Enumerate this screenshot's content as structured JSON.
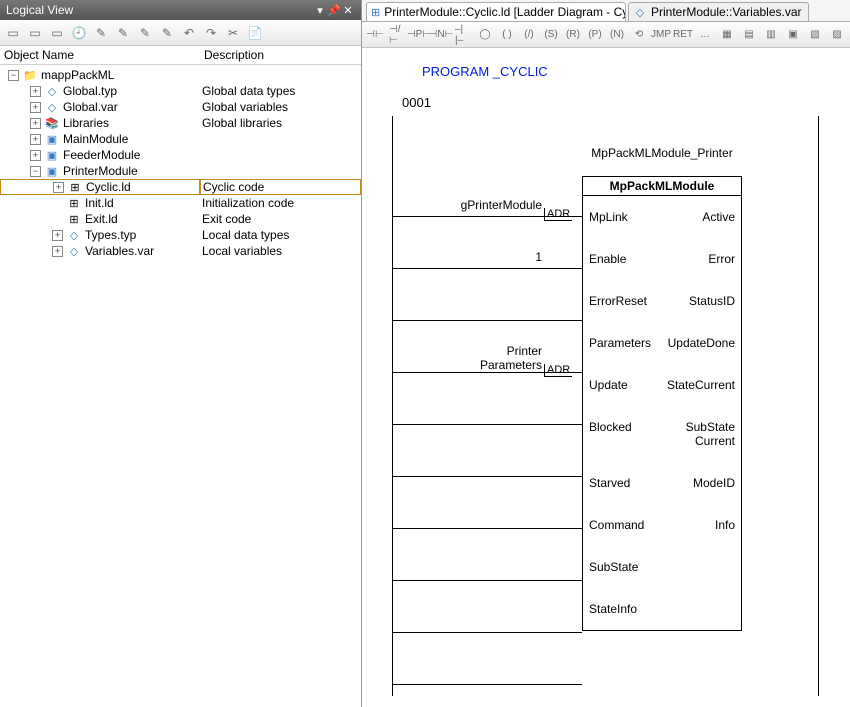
{
  "left": {
    "title": "Logical View",
    "columns": {
      "name": "Object Name",
      "desc": "Description"
    },
    "tree": [
      {
        "indent": 0,
        "toggle": "−",
        "icon": "folder",
        "label": "mappPackML",
        "desc": ""
      },
      {
        "indent": 1,
        "toggle": "+",
        "icon": "file",
        "label": "Global.typ",
        "desc": "Global data types"
      },
      {
        "indent": 1,
        "toggle": "+",
        "icon": "file",
        "label": "Global.var",
        "desc": "Global variables"
      },
      {
        "indent": 1,
        "toggle": "+",
        "icon": "lib",
        "label": "Libraries",
        "desc": "Global libraries"
      },
      {
        "indent": 1,
        "toggle": "+",
        "icon": "pkg",
        "label": "MainModule",
        "desc": ""
      },
      {
        "indent": 1,
        "toggle": "+",
        "icon": "pkg",
        "label": "FeederModule",
        "desc": ""
      },
      {
        "indent": 1,
        "toggle": "−",
        "icon": "pkg",
        "label": "PrinterModule",
        "desc": ""
      },
      {
        "indent": 2,
        "toggle": "+",
        "icon": "ld",
        "label": "Cyclic.ld",
        "desc": "Cyclic code",
        "selected": true
      },
      {
        "indent": 2,
        "toggle": "",
        "icon": "ld",
        "label": "Init.ld",
        "desc": "Initialization code"
      },
      {
        "indent": 2,
        "toggle": "",
        "icon": "ld",
        "label": "Exit.ld",
        "desc": "Exit code"
      },
      {
        "indent": 2,
        "toggle": "+",
        "icon": "file",
        "label": "Types.typ",
        "desc": "Local data types"
      },
      {
        "indent": 2,
        "toggle": "+",
        "icon": "file",
        "label": "Variables.var",
        "desc": "Local variables"
      }
    ]
  },
  "tabs": [
    {
      "label": "PrinterModule::Cyclic.ld [Ladder Diagram - Cyclic]*",
      "active": true,
      "closable": true
    },
    {
      "label": "PrinterModule::Variables.var",
      "active": false,
      "closable": false
    }
  ],
  "editor": {
    "program": "PROGRAM _CYCLIC",
    "network": "0001",
    "instance": "MpPackMLModule_Printer",
    "block_type": "MpPackMLModule",
    "inputs": [
      {
        "sig": "gPrinterModule",
        "adr": "ADR",
        "pin": "MpLink"
      },
      {
        "sig": "1",
        "adr": "",
        "pin": "Enable"
      },
      {
        "sig": "",
        "adr": "",
        "pin": "ErrorReset"
      },
      {
        "sig": "PrinterParameters",
        "adr": "ADR",
        "pin": "Parameters"
      },
      {
        "sig": "",
        "adr": "",
        "pin": "Update"
      },
      {
        "sig": "",
        "adr": "",
        "pin": "Blocked"
      },
      {
        "sig": "",
        "adr": "",
        "pin": "Starved"
      },
      {
        "sig": "",
        "adr": "",
        "pin": "Command"
      },
      {
        "sig": "",
        "adr": "",
        "pin": "SubState"
      },
      {
        "sig": "",
        "adr": "",
        "pin": "StateInfo"
      }
    ],
    "outputs": [
      "Active",
      "Error",
      "StatusID",
      "UpdateDone",
      "StateCurrent",
      "SubStateCurrent",
      "ModeID",
      "Info"
    ]
  },
  "right_tool_glyphs": [
    "⊣⊢",
    "⊣/⊢",
    "⊣P⊢",
    "⊣N⊢",
    "–| |–",
    "◯",
    "( )",
    "(/)",
    "(S)",
    "(R)",
    "(P)",
    "(N)",
    "⟲",
    "JMP",
    "RET",
    "…",
    "▦",
    "▤",
    "▥",
    "▣",
    "▧",
    "▨"
  ],
  "left_tool_glyphs": [
    "▭",
    "▭",
    "▭",
    "🕘",
    "✎",
    "✎",
    "✎",
    "✎",
    "↶",
    "↷",
    "✂",
    "📄"
  ]
}
